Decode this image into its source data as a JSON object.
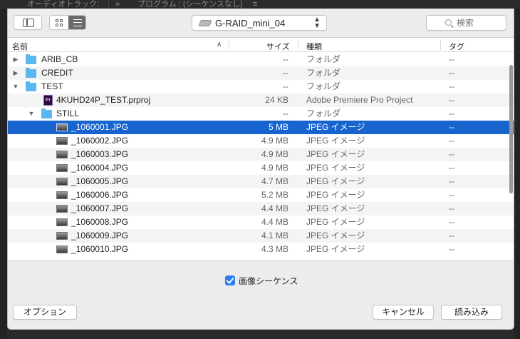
{
  "host": {
    "audio_track_label": "オーディオトラック:",
    "chevron": "»",
    "program_label": "プログラム : (シーケンスなし)",
    "menu_glyph": "≡"
  },
  "toolbar": {
    "location": "G-RAID_mini_04",
    "search_placeholder": "検索"
  },
  "columns": {
    "name": "名前",
    "size": "サイズ",
    "kind": "種類",
    "tag": "タグ"
  },
  "rows": [
    {
      "name": "ARIB_CB",
      "size": "--",
      "kind": "フォルダ",
      "tag": "--",
      "icon": "folder-icon",
      "disclosure": "collapsed"
    },
    {
      "name": "CREDIT",
      "size": "--",
      "kind": "フォルダ",
      "tag": "--",
      "icon": "folder-icon",
      "disclosure": "collapsed"
    },
    {
      "name": "TEST",
      "size": "--",
      "kind": "フォルダ",
      "tag": "--",
      "icon": "folder-icon",
      "disclosure": "expanded"
    },
    {
      "name": "4KUHD24P_TEST.prproj",
      "size": "24 KB",
      "kind": "Adobe Premiere Pro Project",
      "tag": "--",
      "icon": "premiere-project-icon",
      "icon_text": "Pr"
    },
    {
      "name": "STILL",
      "size": "--",
      "kind": "フォルダ",
      "tag": "--",
      "icon": "folder-icon",
      "disclosure": "expanded"
    },
    {
      "name": "_1060001.JPG",
      "size": "5 MB",
      "kind": "JPEG イメージ",
      "tag": "--",
      "icon": "jpeg-thumbnail-icon",
      "selected": true
    },
    {
      "name": "_1060002.JPG",
      "size": "4.9 MB",
      "kind": "JPEG イメージ",
      "tag": "--",
      "icon": "jpeg-thumbnail-icon"
    },
    {
      "name": "_1060003.JPG",
      "size": "4.9 MB",
      "kind": "JPEG イメージ",
      "tag": "--",
      "icon": "jpeg-thumbnail-icon"
    },
    {
      "name": "_1060004.JPG",
      "size": "4.9 MB",
      "kind": "JPEG イメージ",
      "tag": "--",
      "icon": "jpeg-thumbnail-icon"
    },
    {
      "name": "_1060005.JPG",
      "size": "4.7 MB",
      "kind": "JPEG イメージ",
      "tag": "--",
      "icon": "jpeg-thumbnail-icon"
    },
    {
      "name": "_1060006.JPG",
      "size": "5.2 MB",
      "kind": "JPEG イメージ",
      "tag": "--",
      "icon": "jpeg-thumbnail-icon"
    },
    {
      "name": "_1060007.JPG",
      "size": "4.4 MB",
      "kind": "JPEG イメージ",
      "tag": "--",
      "icon": "jpeg-thumbnail-icon"
    },
    {
      "name": "_1060008.JPG",
      "size": "4.4 MB",
      "kind": "JPEG イメージ",
      "tag": "--",
      "icon": "jpeg-thumbnail-icon"
    },
    {
      "name": "_1060009.JPG",
      "size": "4.1 MB",
      "kind": "JPEG イメージ",
      "tag": "--",
      "icon": "jpeg-thumbnail-icon"
    },
    {
      "name": "_1060010.JPG",
      "size": "4.3 MB",
      "kind": "JPEG イメージ",
      "tag": "--",
      "icon": "jpeg-thumbnail-icon"
    }
  ],
  "options": {
    "image_sequence_label": "画像シーケンス",
    "image_sequence_checked": true
  },
  "footer": {
    "options_label": "オプション",
    "cancel_label": "キャンセル",
    "open_label": "読み込み"
  },
  "colors": {
    "selection": "#1764cf",
    "folder": "#58b8ef",
    "checkbox": "#2f7ef2"
  }
}
